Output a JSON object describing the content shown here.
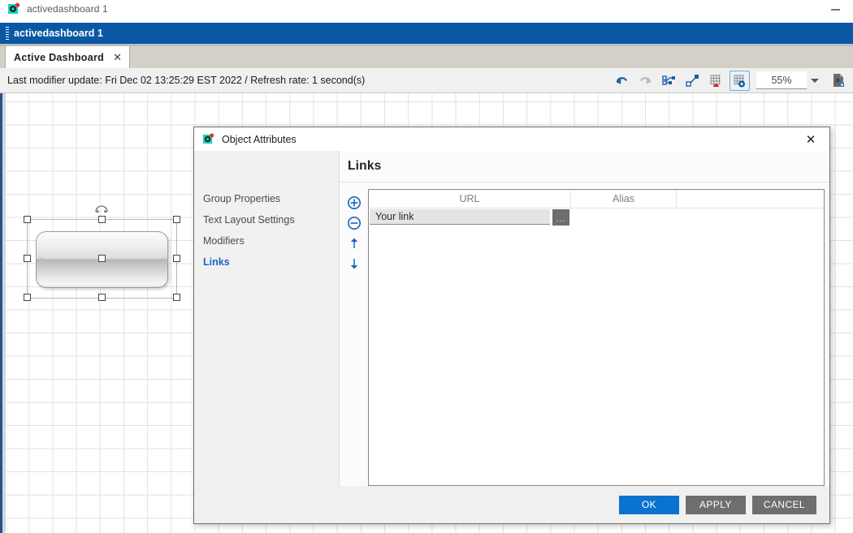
{
  "os_window": {
    "title": "activedashboard 1",
    "icon": "app-icon",
    "minimize_label": "–"
  },
  "app": {
    "caption_title": "activedashboard 1",
    "tabs": [
      {
        "label": "Active Dashboard",
        "close_label": "✕",
        "active": true
      }
    ],
    "status": {
      "info_text": "Last modifier update: Fri Dec 02 13:25:29 EST 2022 / Refresh rate: 1 second(s)"
    },
    "toolbar": {
      "buttons": [
        {
          "name": "undo-icon",
          "title": "Undo",
          "enabled": true
        },
        {
          "name": "redo-icon",
          "title": "Redo",
          "enabled": false
        },
        {
          "name": "distribute-icon",
          "title": "Distribute",
          "enabled": true
        },
        {
          "name": "connector-icon",
          "title": "Connector",
          "enabled": true
        },
        {
          "name": "snap-to-grid-icon",
          "title": "Snap to grid",
          "enabled": true
        },
        {
          "name": "show-grid-icon",
          "title": "Show grid",
          "enabled": true,
          "active": true
        }
      ],
      "zoom_value": "55%",
      "export_icon": "export-document-icon"
    }
  },
  "canvas": {
    "shape": {
      "name": "rounded-rect-shape",
      "selected": true
    },
    "handles_count": 8
  },
  "dialog": {
    "title": "Object Attributes",
    "icon": "app-icon",
    "close_label": "✕",
    "nav": {
      "items": [
        {
          "label": "Group Properties",
          "selected": false
        },
        {
          "label": "Text Layout Settings",
          "selected": false
        },
        {
          "label": "Modifiers",
          "selected": false
        },
        {
          "label": "Links",
          "selected": true
        }
      ]
    },
    "content": {
      "heading": "Links",
      "row_tools": [
        {
          "name": "add-row-icon",
          "label": "Add"
        },
        {
          "name": "remove-row-icon",
          "label": "Remove"
        },
        {
          "name": "move-up-icon",
          "label": "Move up"
        },
        {
          "name": "move-down-icon",
          "label": "Move down"
        }
      ],
      "table": {
        "columns": [
          "URL",
          "Alias"
        ],
        "rows": [
          {
            "url": "Your link",
            "alias": "",
            "browse_label": "..."
          }
        ]
      }
    },
    "footer": {
      "ok_label": "OK",
      "apply_label": "APPLY",
      "cancel_label": "CANCEL"
    }
  },
  "colors": {
    "caption_blue": "#0a57a4",
    "accent_blue": "#1565c0",
    "primary_button": "#0a72d0",
    "grey_button": "#6e6e6e"
  }
}
